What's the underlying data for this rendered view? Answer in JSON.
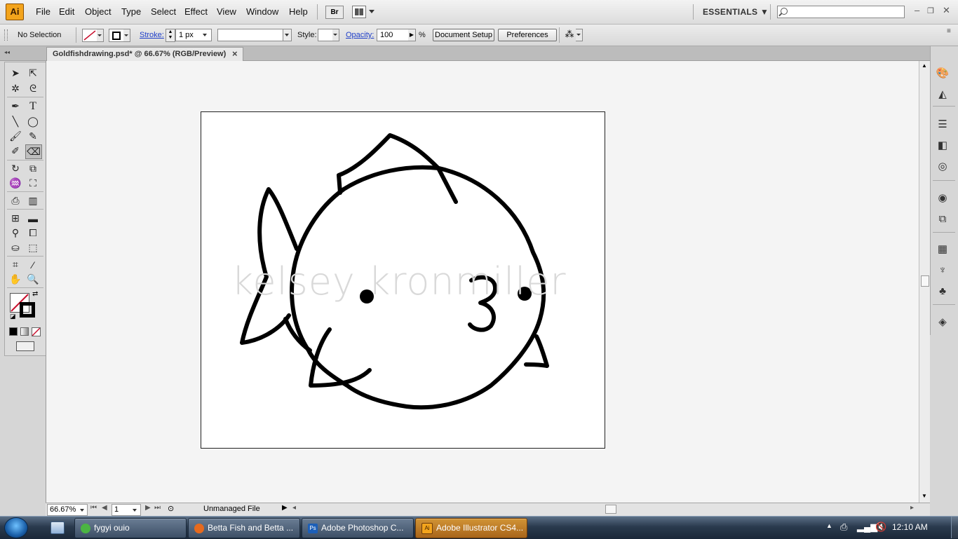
{
  "menubar": {
    "logo": "Ai",
    "items": [
      "File",
      "Edit",
      "Object",
      "Type",
      "Select",
      "Effect",
      "View",
      "Window",
      "Help"
    ],
    "bridge_button": "Br",
    "workspace": "ESSENTIALS ▼",
    "window_controls": [
      "–",
      "❐",
      "✕"
    ]
  },
  "control": {
    "selection": "No Selection",
    "stroke_label": "Stroke:",
    "stroke_weight": "1 px",
    "style_label": "Style:",
    "opacity_label": "Opacity:",
    "opacity_value": "100",
    "opacity_unit": "%",
    "document_setup": "Document Setup",
    "preferences": "Preferences"
  },
  "document": {
    "tab_title": "Goldfishdrawing.psd* @ 66.67% (RGB/Preview)",
    "tab_close": "×"
  },
  "artwork": {
    "watermark": "kelsey kronmiller"
  },
  "status": {
    "zoom": "66.67%",
    "page": "1",
    "file_status": "Unmanaged File"
  },
  "taskbar": {
    "items": [
      {
        "label": "fygyi ouio",
        "color": "#4bb543"
      },
      {
        "label": "Betta Fish and Betta ...",
        "color": "#e66a1e"
      },
      {
        "label": "Adobe Photoshop C...",
        "color": "#1c5fb8"
      },
      {
        "label": "Adobe Illustrator CS4...",
        "color": "#f3a41c"
      }
    ],
    "clock": "12:10 AM"
  },
  "colors": {
    "accent_link": "#1e3ec9",
    "illustrator_orange": "#f3a41c"
  }
}
